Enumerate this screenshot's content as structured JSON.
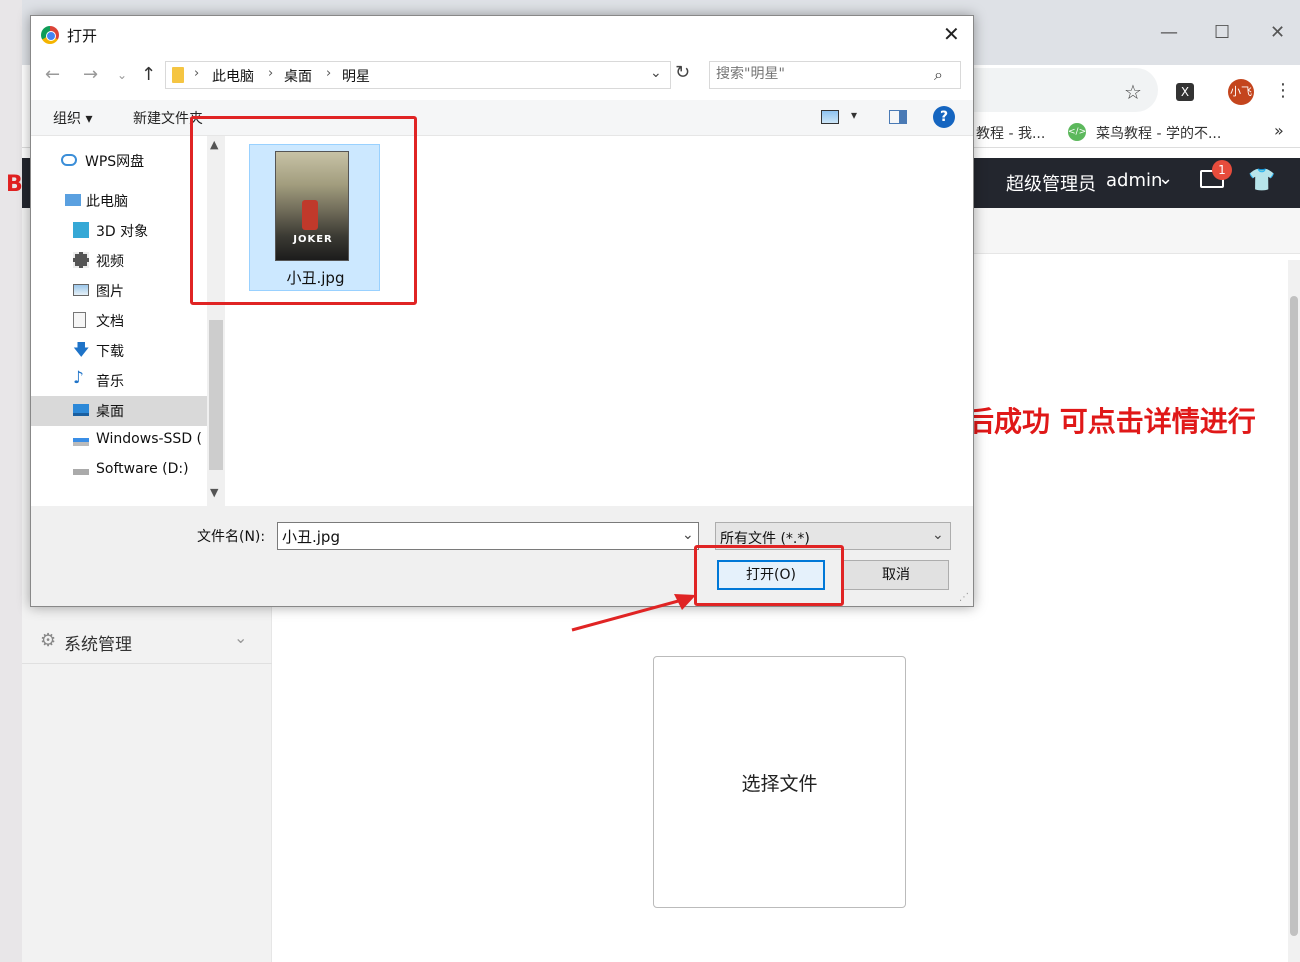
{
  "browser": {
    "window_controls": {
      "minimize": "—",
      "maximize": "☐",
      "close": "✕"
    },
    "profile_label": "小飞",
    "extension_label": "X",
    "bookmarks": [
      {
        "label": "教程 - 我..."
      },
      {
        "label": "菜鸟教程 - 学的不..."
      }
    ],
    "bookmarks_more": "»"
  },
  "app": {
    "admin_role": "超级管理员",
    "admin_name": "admin",
    "mail_badge": "1",
    "sidebar_items": [
      {
        "label": "系统管理"
      }
    ],
    "partial_left_mark": "B",
    "notice_text": "后成功 可点击详情进行",
    "choose_file_label": "选择文件"
  },
  "dialog": {
    "title": "打开",
    "path": [
      "此电脑",
      "桌面",
      "明星"
    ],
    "search_placeholder": "搜索\"明星\"",
    "organize_label": "组织 ▾",
    "new_folder_label": "新建文件夹",
    "nav_items": [
      {
        "label": "WPS网盘",
        "icon": "cloud-icon"
      },
      {
        "label": "此电脑",
        "icon": "computer-icon"
      },
      {
        "label": "3D 对象",
        "icon": "cube-3d-icon"
      },
      {
        "label": "视频",
        "icon": "video-icon"
      },
      {
        "label": "图片",
        "icon": "picture-icon"
      },
      {
        "label": "文档",
        "icon": "document-icon"
      },
      {
        "label": "下载",
        "icon": "download-icon"
      },
      {
        "label": "音乐",
        "icon": "music-icon"
      },
      {
        "label": "桌面",
        "icon": "desktop-icon",
        "selected": true
      },
      {
        "label": "Windows-SSD (",
        "icon": "drive-icon"
      },
      {
        "label": "Software (D:)",
        "icon": "drive-icon"
      }
    ],
    "file": {
      "name": "小丑.jpg",
      "poster_text": "JOKER"
    },
    "filename_label": "文件名(N):",
    "filename_value": "小丑.jpg",
    "filetype_value": "所有文件 (*.*)",
    "open_label": "打开(O)",
    "cancel_label": "取消"
  },
  "colors": {
    "highlight_red": "#e02424",
    "selection_blue": "#cce8ff",
    "accent_blue": "#0078d7"
  }
}
